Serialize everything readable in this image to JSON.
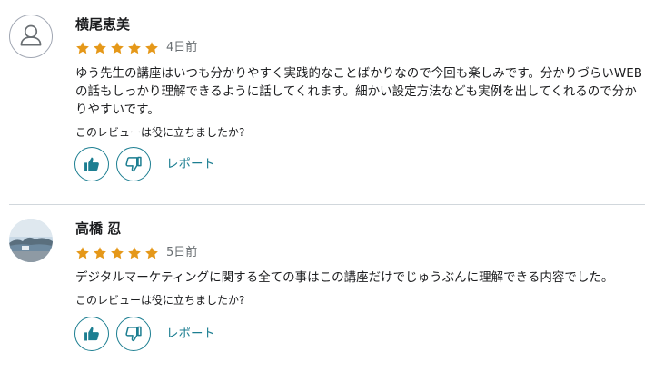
{
  "colors": {
    "star": "#e59819",
    "accent": "#1c7e91",
    "muted": "#6a6f73",
    "divider": "#d1d7dc"
  },
  "reviews": [
    {
      "name": "横尾恵美",
      "avatar": "user-placeholder-icon",
      "rating": 5,
      "date": "4日前",
      "text": "ゆう先生の講座はいつも分かりやすく実践的なことばかりなので今回も楽しみです。分かりづらいWEBの話もしっかり理解できるように話してくれます。細かい設定方法なども実例を出してくれるので分かりやすいです。",
      "helpful_question": "このレビューは役に立ちましたか?",
      "report_label": "レポート"
    },
    {
      "name": "高橋 忍",
      "avatar": "landscape-photo",
      "rating": 5,
      "date": "5日前",
      "text": "デジタルマーケティングに関する全ての事はこの講座だけでじゅうぶんに理解できる内容でした。",
      "helpful_question": "このレビューは役に立ちましたか?",
      "report_label": "レポート"
    }
  ]
}
